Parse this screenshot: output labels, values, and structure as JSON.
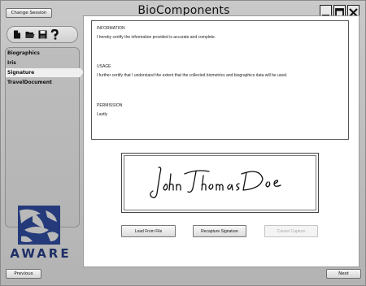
{
  "window": {
    "title": "BioComponents",
    "change_session_label": "Change Session",
    "controls": [
      "minimize-icon",
      "maximize-icon",
      "close-icon"
    ]
  },
  "toolbar": {
    "icons": [
      "new-file-icon",
      "open-folder-icon",
      "save-icon",
      "help-icon"
    ]
  },
  "sidebar": {
    "items": [
      {
        "label": "Biographics",
        "selected": false
      },
      {
        "label": "Iris",
        "selected": false
      },
      {
        "label": "Signature",
        "selected": true
      },
      {
        "label": "TravelDocument",
        "selected": false
      }
    ]
  },
  "agreement": {
    "information_heading": "INFORMATION",
    "information_text": "I hereby certify the information provided is accurate and complete.",
    "usage_heading": "USAGE",
    "usage_text": "I further certify that I understand the extent that the collected biometrics and biographics data will be used.",
    "permission_heading": "PERMISSION",
    "permission_text": "Lastly"
  },
  "signature": {
    "name": "JohnThomasDoe"
  },
  "actions": {
    "load_label": "Load From File",
    "recapture_label": "Recapture Signature",
    "cancel_label": "Cancel Capture"
  },
  "logo": {
    "text": "AWARE"
  },
  "nav": {
    "previous_label": "Previous",
    "next_label": "Next"
  },
  "colors": {
    "logo_blue": "#243a7a",
    "background": "#b9b9b9"
  }
}
